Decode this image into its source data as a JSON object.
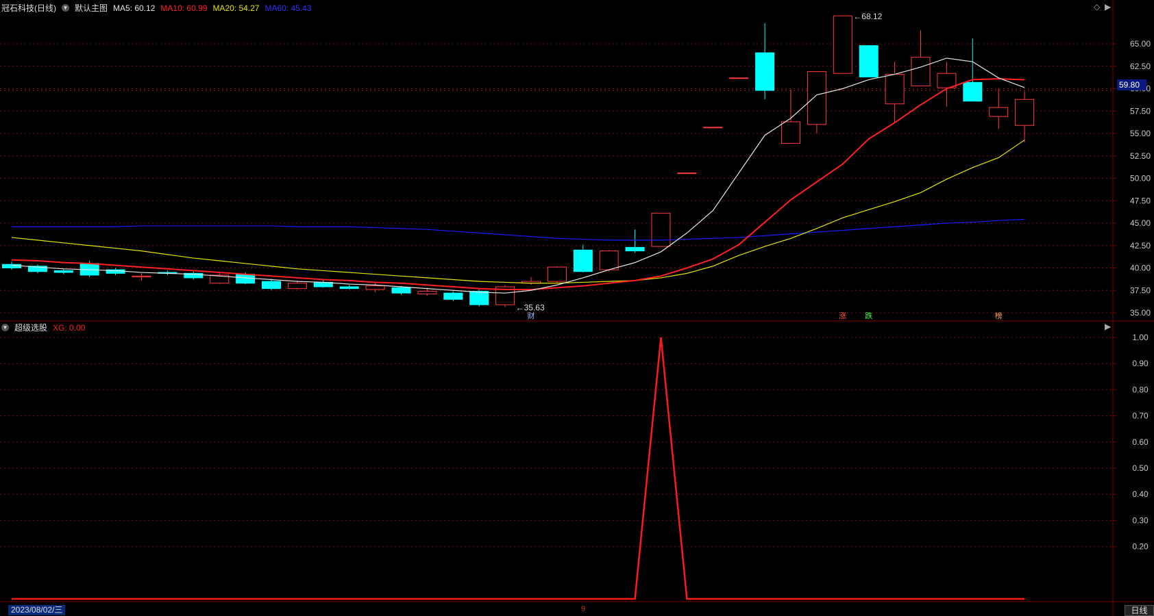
{
  "header": {
    "stock": "冠石科技(日线)",
    "main_chart": "默认主图",
    "ma5": "MA5: 60.12",
    "ma10": "MA10: 60.99",
    "ma20": "MA20: 54.27",
    "ma60": "MA60: 45.43"
  },
  "indicator": {
    "name": "超级选股",
    "value": "XG: 0.00"
  },
  "footer": {
    "date": "2023/08/02/三",
    "tab": "日线",
    "mid_marker": "9"
  },
  "price_current": "59.80",
  "colors": {
    "up": "#ff3b3b",
    "down": "#00ffff",
    "ma5": "#e6e6e6",
    "ma10": "#ff2020",
    "ma20": "#e6e600",
    "ma60": "#1a1aff",
    "axis": "#800000",
    "grid": "#7a1010"
  },
  "chart_data": [
    {
      "type": "candlestick",
      "title": "冠石科技(日线)",
      "ylim": [
        34.0,
        68.5
      ],
      "yticks": [
        "65.00",
        "62.50",
        "60.00",
        "57.50",
        "55.00",
        "52.50",
        "50.00",
        "47.50",
        "45.00",
        "42.50",
        "40.00",
        "37.50",
        "35.00"
      ],
      "candles": [
        {
          "o": 40.4,
          "c": 40.0,
          "h": 40.7,
          "l": 39.8
        },
        {
          "o": 40.2,
          "c": 39.6,
          "h": 40.4,
          "l": 39.4
        },
        {
          "o": 39.7,
          "c": 39.5,
          "h": 39.9,
          "l": 39.3
        },
        {
          "o": 40.5,
          "c": 39.2,
          "h": 40.8,
          "l": 39.0
        },
        {
          "o": 39.8,
          "c": 39.4,
          "h": 40.0,
          "l": 39.2
        },
        {
          "o": 39.0,
          "c": 39.1,
          "h": 39.4,
          "l": 38.6
        },
        {
          "o": 39.5,
          "c": 39.4,
          "h": 39.7,
          "l": 39.2
        },
        {
          "o": 39.4,
          "c": 38.9,
          "h": 39.6,
          "l": 38.7
        },
        {
          "o": 38.3,
          "c": 39.2,
          "h": 39.6,
          "l": 38.2
        },
        {
          "o": 39.3,
          "c": 38.3,
          "h": 39.5,
          "l": 38.2
        },
        {
          "o": 38.5,
          "c": 37.7,
          "h": 38.8,
          "l": 37.5
        },
        {
          "o": 37.7,
          "c": 38.3,
          "h": 38.6,
          "l": 37.6
        },
        {
          "o": 38.4,
          "c": 37.9,
          "h": 38.7,
          "l": 37.8
        },
        {
          "o": 37.9,
          "c": 37.7,
          "h": 38.1,
          "l": 37.6
        },
        {
          "o": 37.6,
          "c": 38.0,
          "h": 38.3,
          "l": 37.3
        },
        {
          "o": 37.8,
          "c": 37.2,
          "h": 38.0,
          "l": 37.0
        },
        {
          "o": 37.1,
          "c": 37.4,
          "h": 37.8,
          "l": 36.9
        },
        {
          "o": 37.2,
          "c": 36.5,
          "h": 37.4,
          "l": 36.3
        },
        {
          "o": 37.4,
          "c": 35.9,
          "h": 37.6,
          "l": 35.7
        },
        {
          "o": 35.9,
          "c": 37.9,
          "h": 38.1,
          "l": 35.63
        },
        {
          "o": 38.3,
          "c": 38.5,
          "h": 39.0,
          "l": 38.1
        },
        {
          "o": 38.5,
          "c": 40.1,
          "h": 40.2,
          "l": 38.3
        },
        {
          "o": 42.0,
          "c": 39.6,
          "h": 42.6,
          "l": 39.5
        },
        {
          "o": 39.8,
          "c": 41.9,
          "h": 42.0,
          "l": 39.6
        },
        {
          "o": 42.3,
          "c": 41.9,
          "h": 44.3,
          "l": 41.7
        },
        {
          "o": 42.4,
          "c": 46.1,
          "h": 46.1,
          "l": 42.4
        },
        {
          "o": 50.6,
          "c": 50.6,
          "h": 50.6,
          "l": 50.6
        },
        {
          "o": 55.7,
          "c": 55.7,
          "h": 55.7,
          "l": 55.7
        },
        {
          "o": 61.2,
          "c": 61.2,
          "h": 61.2,
          "l": 61.2
        },
        {
          "o": 64.0,
          "c": 59.8,
          "h": 67.3,
          "l": 58.8
        },
        {
          "o": 53.9,
          "c": 56.3,
          "h": 59.9,
          "l": 53.9
        },
        {
          "o": 56.0,
          "c": 61.9,
          "h": 61.9,
          "l": 55.0
        },
        {
          "o": 61.7,
          "c": 68.12,
          "h": 68.12,
          "l": 61.7
        },
        {
          "o": 64.8,
          "c": 61.3,
          "h": 64.8,
          "l": 61.3
        },
        {
          "o": 58.3,
          "c": 61.6,
          "h": 63.0,
          "l": 56.3
        },
        {
          "o": 60.3,
          "c": 63.5,
          "h": 66.5,
          "l": 60.3
        },
        {
          "o": 60.1,
          "c": 61.7,
          "h": 63.0,
          "l": 58.0
        },
        {
          "o": 60.7,
          "c": 58.6,
          "h": 65.6,
          "l": 58.6
        },
        {
          "o": 56.9,
          "c": 57.9,
          "h": 60.0,
          "l": 55.5
        },
        {
          "o": 55.9,
          "c": 58.8,
          "h": 59.7,
          "l": 54.0
        }
      ],
      "ma5": [
        40.3,
        40.1,
        39.9,
        39.8,
        39.7,
        39.5,
        39.4,
        39.3,
        39.1,
        38.9,
        38.7,
        38.5,
        38.4,
        38.2,
        38.1,
        37.9,
        37.7,
        37.5,
        37.3,
        37.2,
        37.5,
        38.1,
        38.9,
        39.8,
        40.6,
        41.8,
        43.9,
        46.4,
        50.6,
        54.8,
        56.7,
        59.3,
        60.0,
        61.0,
        61.6,
        62.4,
        63.4,
        63.0,
        61.2,
        60.12
      ],
      "ma10": [
        40.9,
        40.8,
        40.6,
        40.5,
        40.3,
        40.1,
        39.9,
        39.7,
        39.5,
        39.3,
        39.1,
        38.9,
        38.7,
        38.6,
        38.4,
        38.3,
        38.1,
        37.9,
        37.7,
        37.6,
        37.6,
        37.8,
        38.0,
        38.3,
        38.6,
        39.1,
        40.0,
        41.0,
        42.6,
        45.1,
        47.6,
        49.6,
        51.6,
        54.4,
        56.2,
        58.2,
        60.0,
        61.0,
        61.1,
        60.99
      ],
      "ma20": [
        43.4,
        43.1,
        42.8,
        42.5,
        42.2,
        41.9,
        41.5,
        41.1,
        40.8,
        40.5,
        40.2,
        39.9,
        39.7,
        39.5,
        39.3,
        39.1,
        38.9,
        38.7,
        38.5,
        38.4,
        38.3,
        38.3,
        38.4,
        38.5,
        38.6,
        38.9,
        39.4,
        40.2,
        41.4,
        42.4,
        43.3,
        44.4,
        45.6,
        46.5,
        47.4,
        48.4,
        49.9,
        51.2,
        52.3,
        54.27
      ],
      "ma60": [
        44.6,
        44.6,
        44.6,
        44.6,
        44.6,
        44.7,
        44.7,
        44.7,
        44.7,
        44.7,
        44.7,
        44.6,
        44.6,
        44.6,
        44.5,
        44.4,
        44.3,
        44.1,
        43.9,
        43.7,
        43.5,
        43.3,
        43.2,
        43.1,
        43.1,
        43.1,
        43.2,
        43.3,
        43.4,
        43.6,
        43.8,
        44.0,
        44.2,
        44.4,
        44.6,
        44.8,
        45.0,
        45.1,
        45.3,
        45.43
      ],
      "annotations": [
        {
          "index": 32,
          "price": 68.12,
          "text": "68.12"
        },
        {
          "index": 19,
          "price": 35.63,
          "text": "35.63"
        }
      ],
      "markers": [
        {
          "index": 20,
          "text": "财",
          "color": "#9ab8ff"
        },
        {
          "index": 32,
          "text": "涨",
          "color": "#ff5050"
        },
        {
          "index": 33,
          "text": "跌",
          "color": "#40ff40"
        },
        {
          "index": 38,
          "text": "榜",
          "color": "#ffa040"
        }
      ]
    },
    {
      "type": "line",
      "title": "超级选股",
      "series": [
        {
          "name": "XG",
          "values": [
            0,
            0,
            0,
            0,
            0,
            0,
            0,
            0,
            0,
            0,
            0,
            0,
            0,
            0,
            0,
            0,
            0,
            0,
            0,
            0,
            0,
            0,
            0,
            0,
            0,
            1,
            0,
            0,
            0,
            0,
            0,
            0,
            0,
            0,
            0,
            0,
            0,
            0,
            0,
            0
          ]
        }
      ],
      "ylim": [
        0,
        1.0
      ],
      "yticks": [
        "1.00",
        "0.90",
        "0.80",
        "0.70",
        "0.60",
        "0.50",
        "0.40",
        "0.30",
        "0.20"
      ]
    }
  ]
}
